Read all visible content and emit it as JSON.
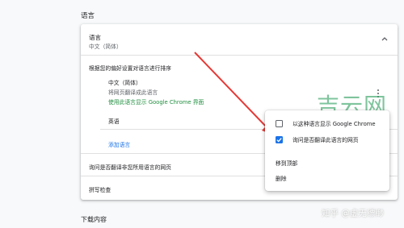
{
  "section": {
    "title": "语言"
  },
  "language_row": {
    "title": "语言",
    "current": "中文（简体）",
    "icon": "chevron-up-icon"
  },
  "order_hint": "根据您的偏好设置对语言进行排序",
  "languages": [
    {
      "name": "中文（简体）",
      "note": "将网页翻译成此语言",
      "ui_note": "使用此语言显示 Google Chrome 界面"
    },
    {
      "name": "英语"
    }
  ],
  "add_language": "添加语言",
  "offer_translate": "询问是否翻译非您所用语言的网页",
  "spell_check": "拼写检查",
  "context_menu": {
    "items": [
      {
        "label": "以这种语言显示 Google Chrome",
        "checked": false
      },
      {
        "label": "询问是否翻译此语言的网页",
        "checked": true
      },
      {
        "label": "移到顶部"
      },
      {
        "label": "删除"
      }
    ]
  },
  "next_section": {
    "title": "下载内容"
  },
  "watermarks": {
    "logo": "吉云网",
    "credit": "知乎 @虚无缥缈"
  },
  "colors": {
    "accent": "#1a73e8",
    "green": "#1e8e3e",
    "arrow": "#e53935",
    "background": "#f8f9fa"
  }
}
